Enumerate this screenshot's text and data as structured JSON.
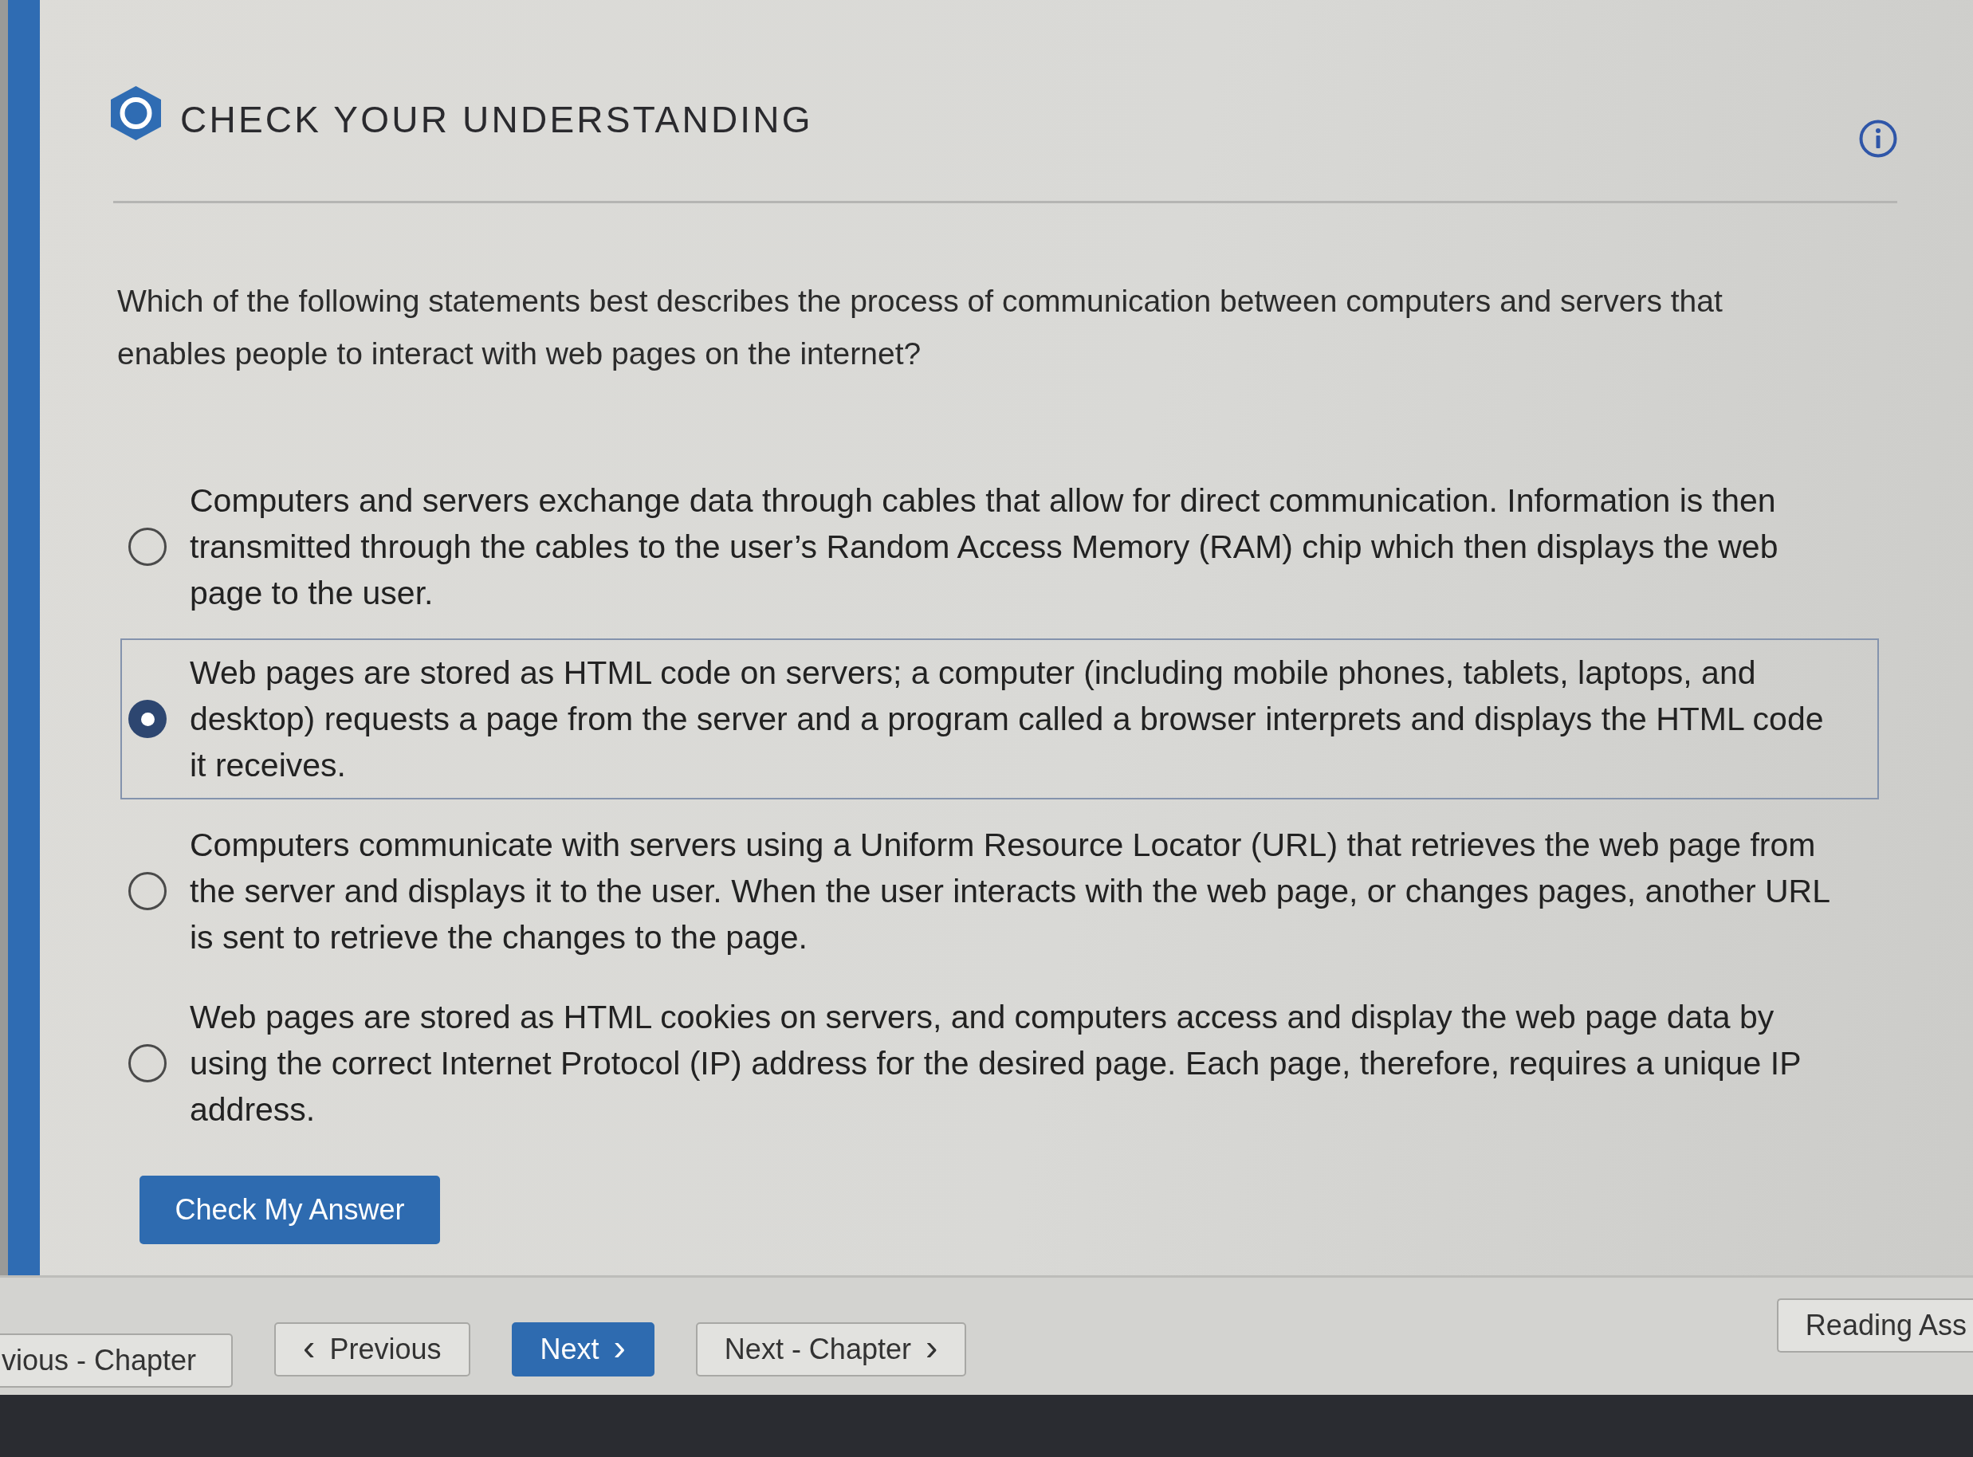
{
  "header": {
    "title": "CHECK YOUR UNDERSTANDING"
  },
  "question": "Which of the following statements best describes the process of communication between computers and servers that enables people to interact with web pages on the internet?",
  "options": [
    {
      "text": "Computers and servers exchange data through cables that allow for direct communication. Information is then transmitted through the cables to the user’s Random Access Memory (RAM) chip which then displays the web page to the user.",
      "selected": false
    },
    {
      "text": "Web pages are stored as HTML code on servers; a computer (including mobile phones, tablets, laptops, and desktop) requests a page from the server and a program called a browser interprets and displays the HTML code it receives.",
      "selected": true
    },
    {
      "text": "Computers communicate with servers using a Uniform Resource Locator (URL) that retrieves the web page from the server and displays it to the user. When the user interacts with the web page, or changes pages, another URL is sent to retrieve the changes to the page.",
      "selected": false
    },
    {
      "text": "Web pages are stored as HTML cookies on servers, and computers access and display the web page data by using the correct Internet Protocol (IP) address for the desired page. Each page, therefore, requires a unique IP address.",
      "selected": false
    }
  ],
  "submit_button": {
    "label": "Check My Answer"
  },
  "navigation": [
    {
      "label": "vious - Chapter",
      "kind": "secondary"
    },
    {
      "label": "Previous",
      "kind": "secondary",
      "leading_icon": "‹"
    },
    {
      "label": "Next",
      "kind": "primary",
      "trailing_icon": "›"
    },
    {
      "label": "Next - Chapter",
      "kind": "secondary",
      "trailing_icon": "›"
    },
    {
      "label": "Reading Ass",
      "kind": "secondary"
    }
  ]
}
